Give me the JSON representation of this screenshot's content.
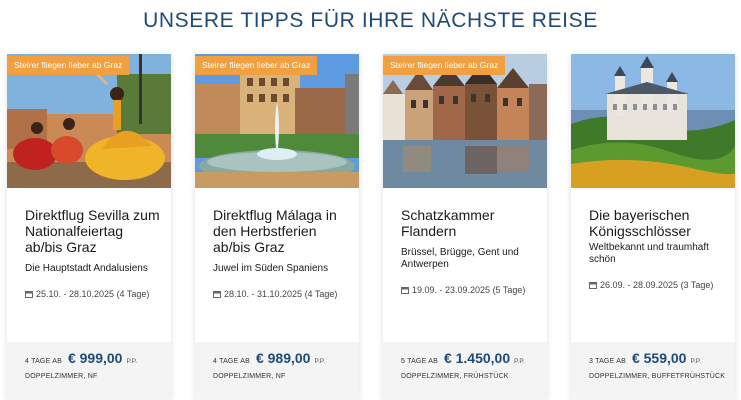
{
  "heading": "UNSERE TIPPS FÜR IHRE NÄCHSTE REISE",
  "colors": {
    "accent": "#1f4a78",
    "badge": "#f0a040"
  },
  "cards": [
    {
      "badge": "Steirer fliegen lieber ab Graz",
      "image": "flamenco-dancers-photo",
      "title": "Direktflug Sevilla zum Nationalfeiertag ab/bis Graz",
      "subtitle": "Die Hauptstadt Andalusiens",
      "date": "25.10. - 28.10.2025 (4 Tage)",
      "days": "4 TAGE AB",
      "price": "€ 999,00",
      "pp": "P.P.",
      "board": "DOPPELZIMMER, NF"
    },
    {
      "badge": "Steirer fliegen lieber ab Graz",
      "image": "malaga-fountain-photo",
      "title": "Direktflug Málaga in den Herbstferien ab/bis Graz",
      "subtitle": "Juwel im Süden Spaniens",
      "date": "28.10. - 31.10.2025 (4 Tage)",
      "days": "4 TAGE AB",
      "price": "€ 989,00",
      "pp": "P.P.",
      "board": "DOPPELZIMMER, NF"
    },
    {
      "badge": "Steirer fliegen lieber ab Graz",
      "image": "flanders-canal-photo",
      "title": "Schatzkammer Flandern",
      "subtitle": "Brüssel, Brügge, Gent und Antwerpen",
      "date": "19.09. - 23.09.2025 (5 Tage)",
      "days": "5 TAGE AB",
      "price": "€ 1.450,00",
      "pp": "P.P.",
      "board": "DOPPELZIMMER, FRÜHSTÜCK"
    },
    {
      "badge": "",
      "image": "neuschwanstein-castle-photo",
      "title": "Die bayerischen Königsschlösser",
      "subtitle": "Weltbekannt und traumhaft schön",
      "date": "26.09. - 28.09.2025 (3 Tage)",
      "days": "3 TAGE AB",
      "price": "€ 559,00",
      "pp": "P.P.",
      "board": "DOPPELZIMMER, BUFFETFRÜHSTÜCK"
    }
  ]
}
